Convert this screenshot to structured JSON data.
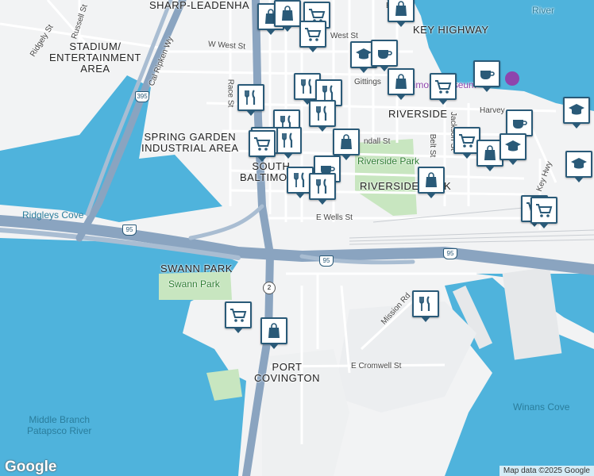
{
  "map": {
    "colors": {
      "water": "#4fb3dc",
      "land": "#f2f3f4",
      "park": "#c8e6c0",
      "highway": "#8aa4c0",
      "road": "#ffffff",
      "marker": "#2a5a78"
    },
    "areas": {
      "sharp_leadenhall": "SHARP-LEADENHA",
      "key_highway": "KEY HIGHWAY",
      "stadium": "STADIUM/\nENTERTAINMENT\nAREA",
      "riverside": "RIVERSIDE",
      "spring_garden": "SPRING GARDEN\nINDUSTRIAL AREA",
      "south_baltimore": "SOUTH\nBALTIMORE",
      "riverside_park_area": "RIVERSIDE PARK",
      "swann_park_area": "SWANN PARK",
      "port_covington": "PORT\nCOVINGTON"
    },
    "streets": {
      "ridgely": "Ridgely St",
      "russell": "Russell St",
      "cal_ripken": "Cal Ripken Wy",
      "w_west": "W West St",
      "west": "West St",
      "race": "Race St",
      "gittings": "Gittings",
      "harvey": "Harvey",
      "jackson": "Jackson St",
      "belt": "Belt St",
      "randall": "ndall St",
      "key_hwy": "Key Hwy",
      "e_wells": "E Wells St",
      "mission": "Mission Rd",
      "e_cromwell": "E Cromwell St",
      "e_c": "E C",
      "river": "River"
    },
    "parks": {
      "riverside_park": "Riverside Park",
      "swann_park": "Swann Park"
    },
    "water": {
      "ridgleys_cove": "Ridgleys Cove",
      "middle_branch": "Middle Branch\nPatapsco River",
      "winans_cove": "Winans Cove"
    },
    "museum": "Baltimore Museum of Industry",
    "routes": {
      "i395": "395",
      "i95_west": "95",
      "i95_mid": "95",
      "i95_east": "95",
      "md2": "2"
    },
    "markers": [
      {
        "type": "shopping"
      },
      {
        "type": "shopping"
      },
      {
        "type": "grocery"
      },
      {
        "type": "shopping"
      },
      {
        "type": "grocery"
      },
      {
        "type": "school"
      },
      {
        "type": "cafe"
      },
      {
        "type": "shopping"
      },
      {
        "type": "grocery"
      },
      {
        "type": "cafe"
      },
      {
        "type": "school"
      },
      {
        "type": "restaurant"
      },
      {
        "type": "restaurant"
      },
      {
        "type": "restaurant"
      },
      {
        "type": "restaurant"
      },
      {
        "type": "restaurant"
      },
      {
        "type": "restaurant"
      },
      {
        "type": "restaurant"
      },
      {
        "type": "shopping"
      },
      {
        "type": "grocery"
      },
      {
        "type": "cafe"
      },
      {
        "type": "restaurant"
      },
      {
        "type": "restaurant"
      },
      {
        "type": "shopping"
      },
      {
        "type": "grocery"
      },
      {
        "type": "shopping"
      },
      {
        "type": "cafe"
      },
      {
        "type": "school"
      },
      {
        "type": "school"
      },
      {
        "type": "grocery"
      },
      {
        "type": "grocery"
      },
      {
        "type": "restaurant"
      },
      {
        "type": "grocery"
      },
      {
        "type": "shopping"
      }
    ],
    "google_logo": "Google",
    "attribution": "Map data ©2025 Google"
  }
}
